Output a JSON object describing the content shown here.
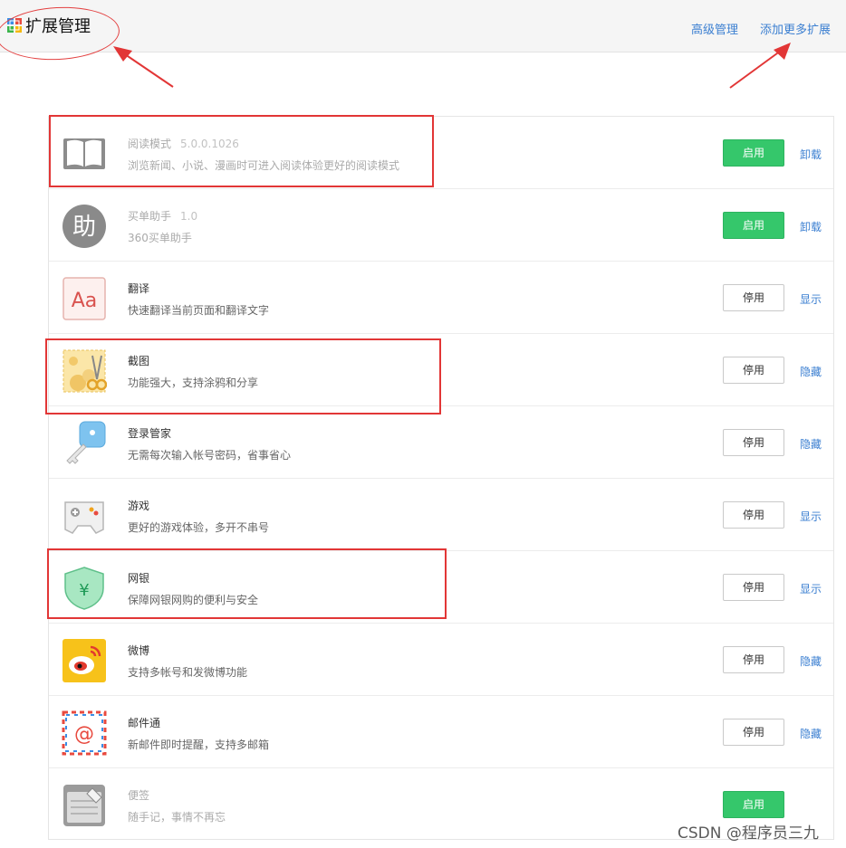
{
  "header": {
    "title": "扩展管理",
    "advanced_label": "高级管理",
    "add_more_label": "添加更多扩展"
  },
  "extensions": [
    {
      "name": "阅读模式",
      "version": "5.0.0.1026",
      "desc": "浏览新闻、小说、漫画时可进入阅读体验更好的阅读模式",
      "button": "启用",
      "action": "卸载",
      "state": "disabled",
      "icon": "book-icon"
    },
    {
      "name": "买单助手",
      "version": "1.0",
      "desc": "360买单助手",
      "button": "启用",
      "action": "卸载",
      "state": "disabled",
      "icon": "helper-icon"
    },
    {
      "name": "翻译",
      "version": "",
      "desc": "快速翻译当前页面和翻译文字",
      "button": "停用",
      "action": "显示",
      "state": "enabled",
      "icon": "translate-icon"
    },
    {
      "name": "截图",
      "version": "",
      "desc": "功能强大，支持涂鸦和分享",
      "button": "停用",
      "action": "隐藏",
      "state": "enabled",
      "icon": "screenshot-icon"
    },
    {
      "name": "登录管家",
      "version": "",
      "desc": "无需每次输入帐号密码，省事省心",
      "button": "停用",
      "action": "隐藏",
      "state": "enabled",
      "icon": "key-icon"
    },
    {
      "name": "游戏",
      "version": "",
      "desc": "更好的游戏体验，多开不串号",
      "button": "停用",
      "action": "显示",
      "state": "enabled",
      "icon": "gamepad-icon"
    },
    {
      "name": "网银",
      "version": "",
      "desc": "保障网银网购的便利与安全",
      "button": "停用",
      "action": "显示",
      "state": "enabled",
      "icon": "shield-icon"
    },
    {
      "name": "微博",
      "version": "",
      "desc": "支持多帐号和发微博功能",
      "button": "停用",
      "action": "隐藏",
      "state": "enabled",
      "icon": "weibo-icon"
    },
    {
      "name": "邮件通",
      "version": "",
      "desc": "新邮件即时提醒，支持多邮箱",
      "button": "停用",
      "action": "隐藏",
      "state": "enabled",
      "icon": "mail-icon"
    },
    {
      "name": "便签",
      "version": "",
      "desc": "随手记，事情不再忘",
      "button": "启用",
      "action": "",
      "state": "disabled",
      "icon": "notepad-icon"
    }
  ],
  "watermark": "CSDN @程序员三九",
  "colors": {
    "enable_button": "#35c76b",
    "link": "#3b7fd1",
    "annotation": "#e23636"
  }
}
